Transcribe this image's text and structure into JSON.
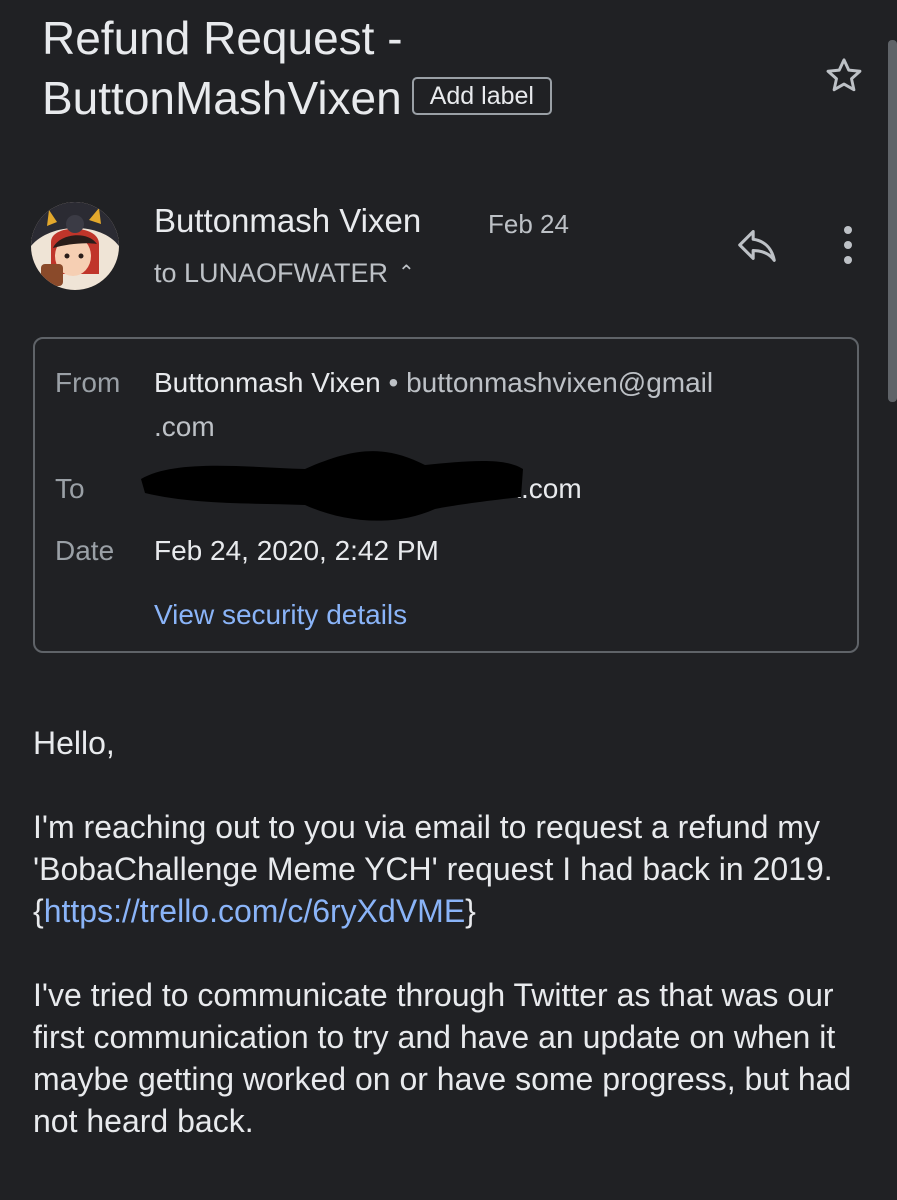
{
  "subject": {
    "title_line1": "Refund Request -",
    "title_line2": "ButtonMashVixen",
    "add_label": "Add label"
  },
  "sender": {
    "name": "Buttonmash Vixen",
    "date": "Feb 24",
    "to": "to LUNAOFWATER"
  },
  "details": {
    "from_label": "From",
    "from_name": "Buttonmash Vixen",
    "from_email_part1": "buttonmashvixen@gmail",
    "from_email_part2": ".com",
    "to_label": "To",
    "to_visible": "k.com",
    "date_label": "Date",
    "date_value": "Feb 24, 2020, 2:42 PM",
    "security_link": "View security details"
  },
  "body": {
    "greeting": "Hello,",
    "para1_text": "I'm reaching out to you via email to request a refund my 'BobaChallenge Meme YCH' request I had back in 2019.",
    "link_open": "{",
    "link_url": "https://trello.com/c/6ryXdVME",
    "link_close": "}",
    "para2": "I've tried to communicate through Twitter as that was our first communication to try and have an update on when it maybe getting worked on or have some progress, but had not heard back."
  },
  "icons": {
    "star": "star-outline-icon",
    "reply": "reply-icon",
    "more": "more-vert-icon",
    "expand": "chevron-up-icon"
  },
  "colors": {
    "background": "#202124",
    "link": "#8ab4f8",
    "text": "#e8eaed",
    "muted": "#9aa0a6"
  }
}
